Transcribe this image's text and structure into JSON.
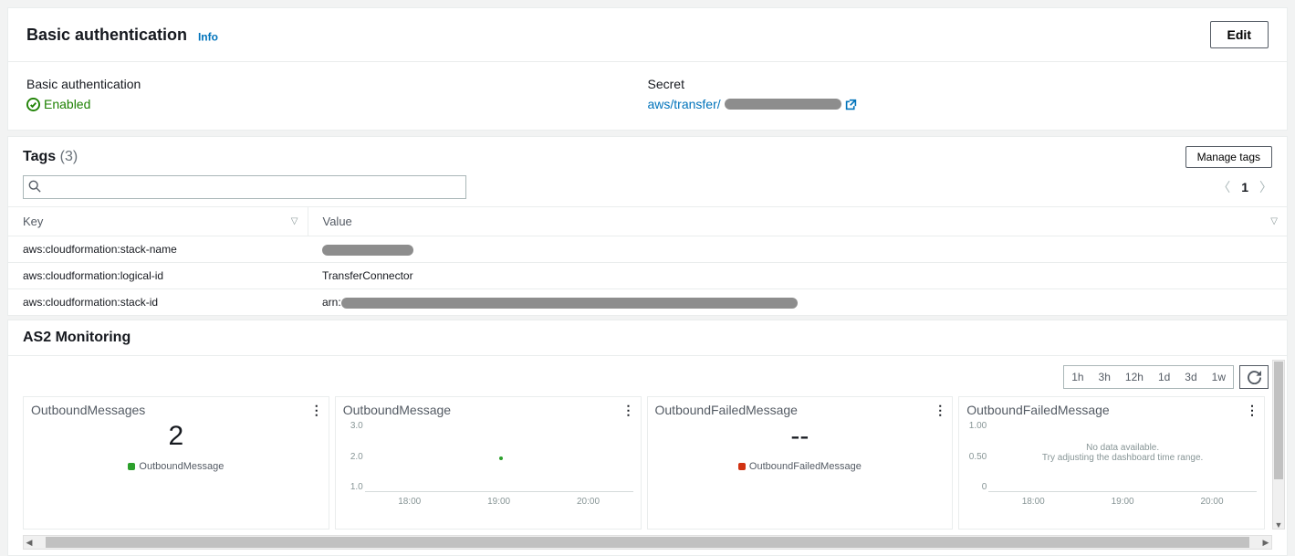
{
  "auth": {
    "title": "Basic authentication",
    "info": "Info",
    "edit": "Edit",
    "label1": "Basic authentication",
    "status": "Enabled",
    "label2": "Secret",
    "secret_prefix": "aws/transfer/"
  },
  "tags": {
    "title": "Tags",
    "count": "(3)",
    "manage": "Manage tags",
    "page": "1",
    "col_key": "Key",
    "col_value": "Value",
    "rows": [
      {
        "key": "aws:cloudformation:stack-name",
        "value": "",
        "redact_w": 100
      },
      {
        "key": "aws:cloudformation:logical-id",
        "value": "TransferConnector",
        "redact_w": 0
      },
      {
        "key": "aws:cloudformation:stack-id",
        "value": "arn:",
        "redact_w": 500
      }
    ]
  },
  "monitoring": {
    "title": "AS2 Monitoring",
    "ranges": [
      "1h",
      "3h",
      "12h",
      "1d",
      "3d",
      "1w"
    ],
    "charts": [
      {
        "title": "OutboundMessages",
        "type": "number",
        "value": "2",
        "legend": "OutboundMessage",
        "legend_color": "green"
      },
      {
        "title": "OutboundMessage",
        "type": "line",
        "yticks": [
          "3.0",
          "2.0",
          "1.0"
        ],
        "xticks": [
          "18:00",
          "19:00",
          "20:00"
        ],
        "point": {
          "x_pct": 50,
          "y_pct": 50
        }
      },
      {
        "title": "OutboundFailedMessage",
        "type": "number",
        "value": "--",
        "legend": "OutboundFailedMessage",
        "legend_color": "red"
      },
      {
        "title": "OutboundFailedMessage",
        "type": "line",
        "yticks": [
          "1.00",
          "0.50",
          "0"
        ],
        "xticks": [
          "18:00",
          "19:00",
          "20:00"
        ],
        "nodata1": "No data available.",
        "nodata2": "Try adjusting the dashboard time range."
      }
    ]
  },
  "chart_data": [
    {
      "type": "table",
      "title": "OutboundMessages",
      "value": 2,
      "series_name": "OutboundMessage"
    },
    {
      "type": "line",
      "title": "OutboundMessage",
      "x": [
        "18:00",
        "19:00",
        "20:00"
      ],
      "ylim": [
        1,
        3
      ],
      "series": [
        {
          "name": "OutboundMessage",
          "values": [
            null,
            2,
            null
          ]
        }
      ],
      "ylabel": "",
      "xlabel": ""
    },
    {
      "type": "table",
      "title": "OutboundFailedMessage",
      "value": null,
      "series_name": "OutboundFailedMessage"
    },
    {
      "type": "line",
      "title": "OutboundFailedMessage",
      "x": [
        "18:00",
        "19:00",
        "20:00"
      ],
      "ylim": [
        0,
        1
      ],
      "series": [
        {
          "name": "OutboundFailedMessage",
          "values": []
        }
      ],
      "note": "No data available. Try adjusting the dashboard time range."
    }
  ]
}
